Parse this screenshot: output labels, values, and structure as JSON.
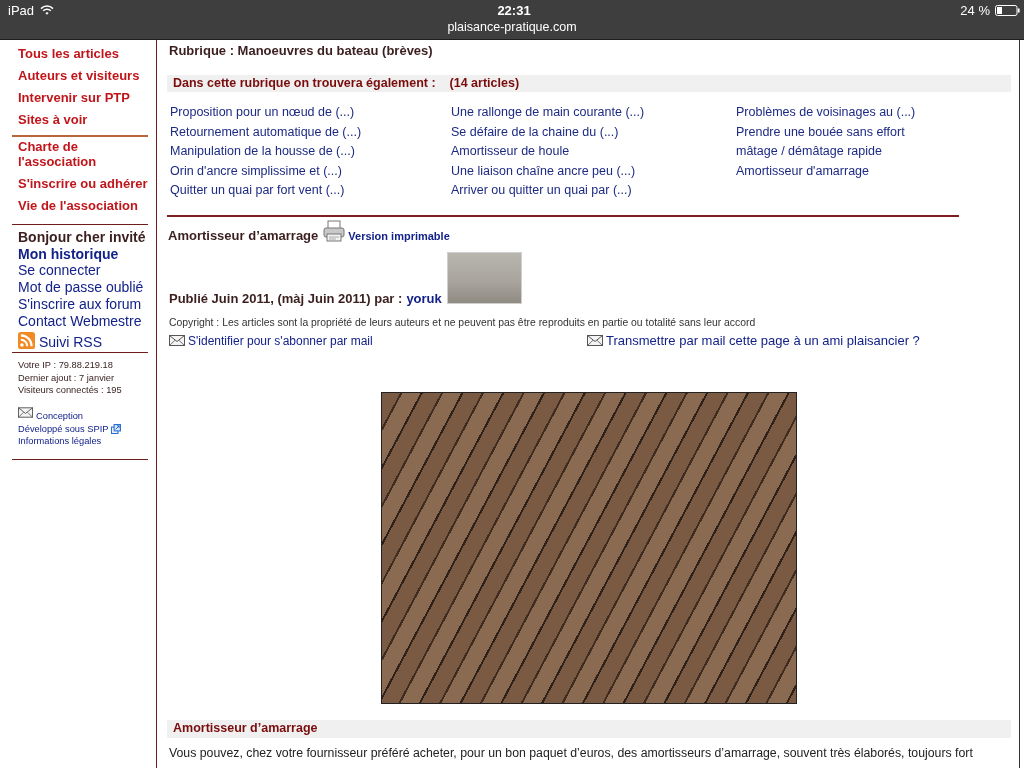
{
  "status_bar": {
    "device": "iPad",
    "time": "22:31",
    "battery": "24 %",
    "url": "plaisance-pratique.com"
  },
  "sidebar": {
    "main_menu": [
      "Tous les articles",
      "Auteurs et visiteurs",
      "Intervenir sur PTP",
      "Sites à voir"
    ],
    "association_menu": [
      "Charte de l'association",
      "S'inscrire ou adhérer",
      "Vie de l'association"
    ],
    "greeting": "Bonjour cher invité",
    "user_links": [
      {
        "label": "Mon historique",
        "kind": "strong"
      },
      {
        "label": "Se connecter",
        "kind": "normal"
      },
      {
        "label": "Mot de passe oublié",
        "kind": "normal"
      },
      {
        "label": "S'inscrire aux forum",
        "kind": "normal"
      },
      {
        "label": "Contact Webmestre",
        "kind": "normal"
      }
    ],
    "rss_link": "Suivi RSS",
    "info_lines": [
      "Votre IP : 79.88.219.18",
      "Dernier ajout : 7 janvier",
      "Visiteurs connectés : 195"
    ],
    "footer_links": [
      {
        "label": "Conception",
        "kind": "mail"
      },
      {
        "label": "Développé sous SPIP",
        "kind": "external"
      },
      {
        "label": "Informations légales",
        "kind": "plain"
      }
    ]
  },
  "main": {
    "rubrique_title": "Rubrique : Manoeuvres du bateau (brèves)",
    "related": {
      "heading": "Dans cette rubrique on trouvera également :",
      "count": "(14 articles)",
      "columns": [
        [
          "Proposition pour un nœud de (...)",
          "Retournement automatique de (...)",
          "Manipulation de la housse de (...)",
          "Orin d'ancre simplissime et (...)",
          "Quitter un quai par fort vent (...)"
        ],
        [
          "Une rallonge de main courante (...)",
          "Se défaire de la chaine du (...)",
          "Amortisseur de houle",
          "Une liaison chaîne ancre peu (...)",
          "Arriver ou quitter un quai par (...)"
        ],
        [
          "Problèmes de voisinages au (...)",
          "Prendre une bouée sans effort",
          "mâtage / démâtage rapide",
          "Amortisseur d'amarrage"
        ]
      ]
    },
    "article": {
      "title": "Amortisseur d’amarrage",
      "print_link": "Version imprimable",
      "byline": "Publié Juin 2011, (màj Juin 2011) par :",
      "author": "yoruk",
      "copyright": "Copyright : Les articles sont la propriété de leurs auteurs et ne peuvent pas être reproduits en partie ou totalité sans leur accord",
      "subscribe_link": "S'identifier pour s'abonner par mail",
      "forward_link": "Transmettre par mail cette page à un ami plaisancier ?",
      "section_heading": "Amortisseur d’amarrage",
      "body": "Vous pouvez, chez votre fournisseur préféré acheter, pour un bon paquet d’euros, des amortisseurs d’amarrage, souvent très élaborés, toujours fort"
    }
  }
}
